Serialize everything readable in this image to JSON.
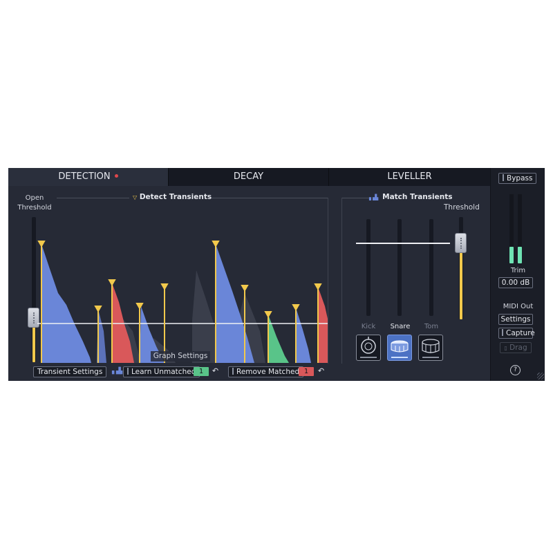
{
  "tabs": [
    {
      "label": "DETECTION",
      "active": true
    },
    {
      "label": "DECAY",
      "active": false
    },
    {
      "label": "LEVELLER",
      "active": false
    }
  ],
  "detection": {
    "open_threshold_label_1": "Open",
    "open_threshold_label_2": "Threshold",
    "detect_transients_label": "Detect Transients",
    "graph_settings_label": "Graph Settings",
    "transient_settings_button": "Transient Settings",
    "learn_unmatched_button": "Learn Unmatched",
    "learn_unmatched_value": "1",
    "remove_matched_button": "Remove Matched",
    "remove_matched_value": "1"
  },
  "match": {
    "title": "Match Transients",
    "threshold_label": "Threshold",
    "drums": [
      {
        "label": "Kick",
        "active": false
      },
      {
        "label": "Snare",
        "active": true
      },
      {
        "label": "Tom",
        "active": false
      }
    ]
  },
  "side": {
    "bypass_label": "Bypass",
    "trim_label": "Trim",
    "trim_value": "0.00 dB",
    "midi_out_label": "MIDI Out",
    "settings_button": "Settings",
    "capture_button": "Capture",
    "drag_button": "Drag",
    "help_glyph": "?"
  },
  "colors": {
    "accent_yellow": "#f2c94c",
    "blue": "#6a86d8",
    "red": "#d9585a",
    "green": "#59c489",
    "teal": "#6fe3b3"
  }
}
